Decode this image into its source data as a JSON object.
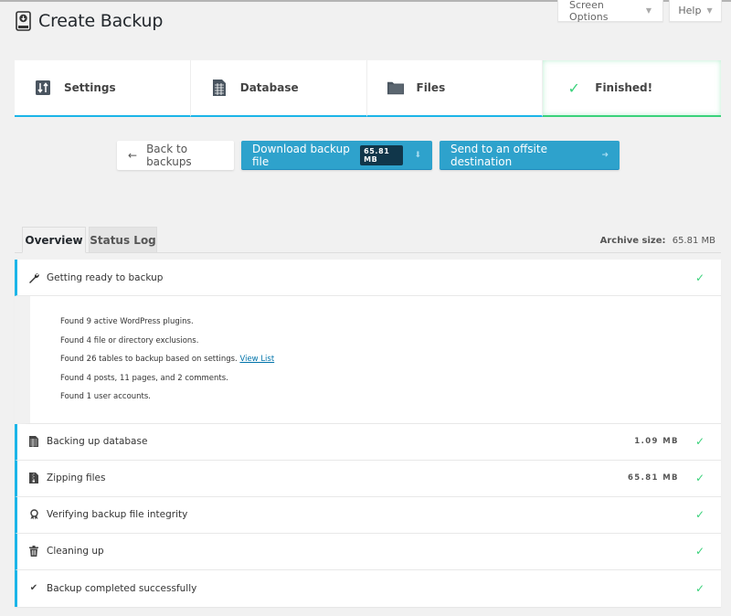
{
  "header": {
    "title": "Create Backup",
    "screen_options_label": "Screen Options",
    "help_label": "Help"
  },
  "steps": [
    {
      "label": "Settings",
      "icon": "settings-sliders-icon"
    },
    {
      "label": "Database",
      "icon": "database-icon"
    },
    {
      "label": "Files",
      "icon": "folder-icon"
    },
    {
      "label": "Finished!",
      "icon": "check-icon"
    }
  ],
  "actions": {
    "back_label": "Back to backups",
    "download_label": "Download backup file",
    "download_size": "65.81 MB",
    "offsite_label": "Send to an offsite destination"
  },
  "tabs": {
    "overview": "Overview",
    "status_log": "Status Log",
    "archive_size_label": "Archive size:",
    "archive_size_value": "65.81 MB"
  },
  "rows": [
    {
      "label": "Getting ready to backup",
      "icon": "wrench-icon",
      "size": "",
      "status": "complete"
    },
    {
      "label": "Backing up database",
      "icon": "database-icon",
      "size": "1.09 MB",
      "status": "complete"
    },
    {
      "label": "Zipping files",
      "icon": "zip-file-icon",
      "size": "65.81 MB",
      "status": "complete"
    },
    {
      "label": "Verifying backup file integrity",
      "icon": "award-icon",
      "size": "",
      "status": "complete"
    },
    {
      "label": "Cleaning up",
      "icon": "trash-icon",
      "size": "",
      "status": "complete"
    },
    {
      "label": "Backup completed successfully",
      "icon": "check-icon",
      "size": "",
      "status": "complete"
    }
  ],
  "details": {
    "line1": "Found 9 active WordPress plugins.",
    "line2": "Found 4 file or directory exclusions.",
    "line3": "Found 26 tables to backup based on settings.",
    "line3_link": "View List",
    "line4": "Found 4 posts, 11 pages, and 2 comments.",
    "line5": "Found 1 user accounts."
  },
  "colors": {
    "accent_blue": "#1bb5e8",
    "button_blue": "#2ea2cc",
    "success_green": "#3ad27b"
  }
}
